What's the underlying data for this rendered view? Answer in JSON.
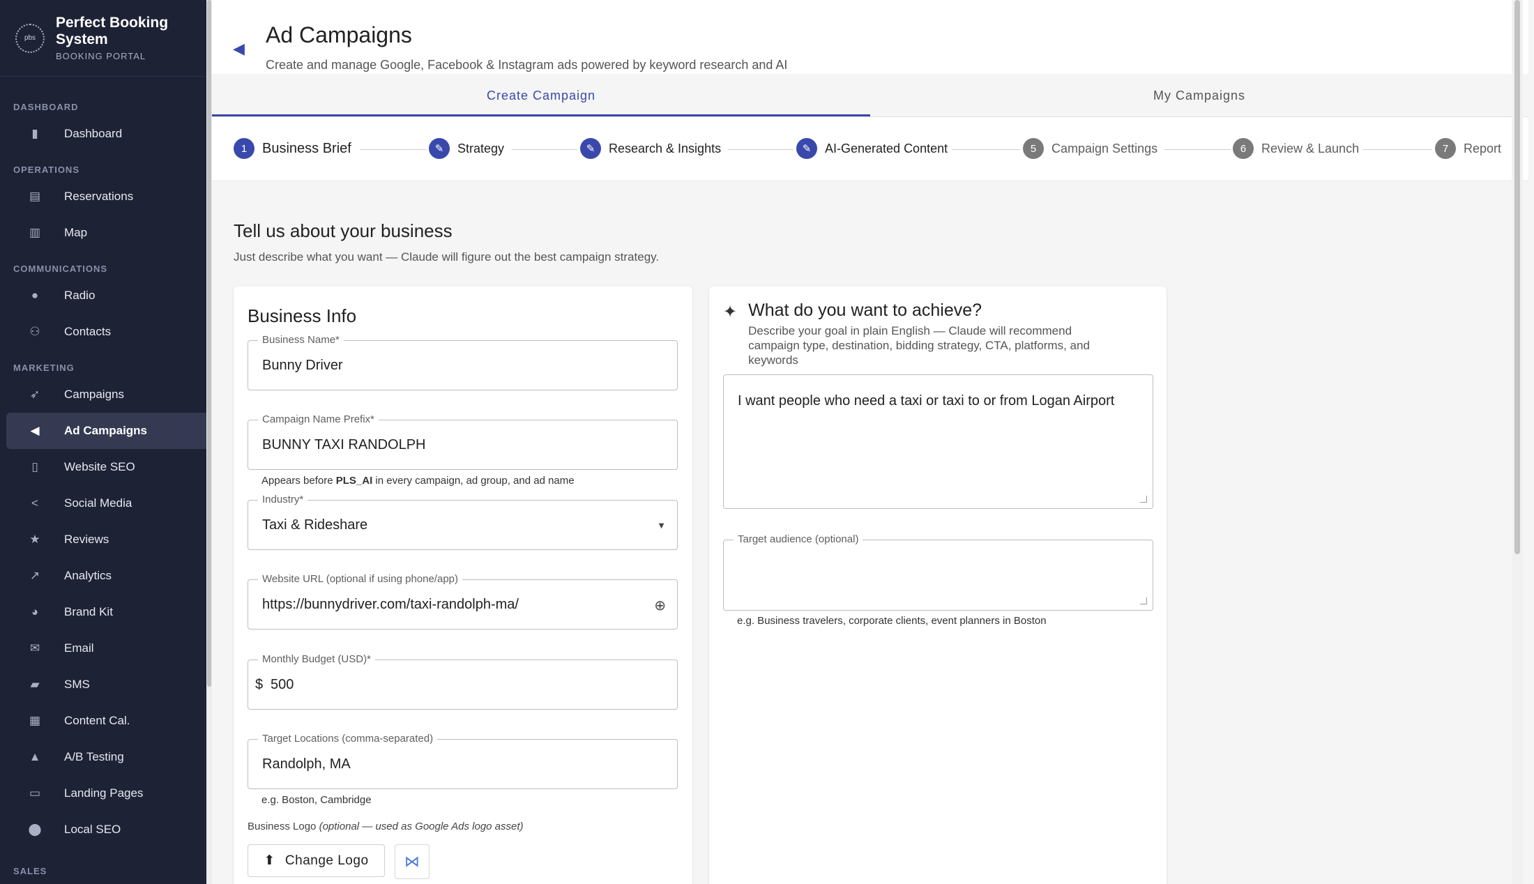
{
  "brand": {
    "logo_text": "pbs",
    "title": "Perfect Booking System",
    "subtitle": "BOOKING PORTAL"
  },
  "sidebar": {
    "sections": [
      {
        "label": "DASHBOARD",
        "items": [
          {
            "label": "Dashboard",
            "icon": "bar-chart-icon"
          }
        ]
      },
      {
        "label": "OPERATIONS",
        "items": [
          {
            "label": "Reservations",
            "icon": "clipboard-icon"
          },
          {
            "label": "Map",
            "icon": "map-icon"
          }
        ]
      },
      {
        "label": "COMMUNICATIONS",
        "items": [
          {
            "label": "Radio",
            "icon": "mic-icon"
          },
          {
            "label": "Contacts",
            "icon": "people-icon"
          }
        ]
      },
      {
        "label": "MARKETING",
        "items": [
          {
            "label": "Campaigns",
            "icon": "rocket-icon"
          },
          {
            "label": "Ad Campaigns",
            "icon": "megaphone-icon",
            "active": true
          },
          {
            "label": "Website SEO",
            "icon": "book-icon"
          },
          {
            "label": "Social Media",
            "icon": "share-icon"
          },
          {
            "label": "Reviews",
            "icon": "star-icon"
          },
          {
            "label": "Analytics",
            "icon": "trend-icon"
          },
          {
            "label": "Brand Kit",
            "icon": "palette-icon"
          },
          {
            "label": "Email",
            "icon": "mail-icon"
          },
          {
            "label": "SMS",
            "icon": "sms-icon"
          },
          {
            "label": "Content Cal.",
            "icon": "calendar-icon"
          },
          {
            "label": "A/B Testing",
            "icon": "flask-icon"
          },
          {
            "label": "Landing Pages",
            "icon": "web-icon"
          },
          {
            "label": "Local SEO",
            "icon": "pin-icon"
          }
        ]
      },
      {
        "label": "SALES",
        "items": []
      }
    ]
  },
  "header": {
    "title": "Ad Campaigns",
    "subtitle": "Create and manage Google, Facebook & Instagram ads powered by keyword research and AI"
  },
  "tabs": [
    {
      "label": "Create Campaign",
      "active": true
    },
    {
      "label": "My Campaigns"
    }
  ],
  "steps": [
    {
      "num": "1",
      "label": "Business Brief",
      "state": "current"
    },
    {
      "num": "",
      "label": "Strategy",
      "state": "done"
    },
    {
      "num": "",
      "label": "Research & Insights",
      "state": "done"
    },
    {
      "num": "",
      "label": "AI-Generated Content",
      "state": "done"
    },
    {
      "num": "5",
      "label": "Campaign Settings",
      "state": "todo"
    },
    {
      "num": "6",
      "label": "Review & Launch",
      "state": "todo"
    },
    {
      "num": "7",
      "label": "Report",
      "state": "todo"
    }
  ],
  "content": {
    "title": "Tell us about your business",
    "subtitle": "Just describe what you want — Claude will figure out the best campaign strategy."
  },
  "business_info": {
    "heading": "Business Info",
    "business_name": {
      "label": "Business Name*",
      "value": "Bunny Driver"
    },
    "campaign_prefix": {
      "label": "Campaign Name Prefix*",
      "value": "BUNNY TAXI RANDOLPH",
      "helper_pre": "Appears before ",
      "helper_bold": "PLS_AI",
      "helper_post": " in every campaign, ad group, and ad name"
    },
    "industry": {
      "label": "Industry*",
      "value": "Taxi & Rideshare"
    },
    "website": {
      "label": "Website URL (optional if using phone/app)",
      "value": "https://bunnydriver.com/taxi-randolph-ma/"
    },
    "budget": {
      "label": "Monthly Budget (USD)*",
      "prefix": "$",
      "value": "500"
    },
    "locations": {
      "label": "Target Locations (comma-separated)",
      "value": "Randolph, MA",
      "helper": "e.g. Boston, Cambridge"
    },
    "logo": {
      "label": "Business Logo",
      "label_note": "(optional — used as Google Ads logo asset)",
      "button": "Change Logo"
    }
  },
  "goal": {
    "heading": "What do you want to achieve?",
    "description": "Describe your goal in plain English — Claude will recommend campaign type, destination, bidding strategy, CTA, platforms, and keywords",
    "value": "I want people who need a taxi or taxi to or from Logan Airport",
    "audience": {
      "label": "Target audience (optional)",
      "value": "",
      "helper": "e.g. Business travelers, corporate clients, event planners in Boston"
    }
  }
}
